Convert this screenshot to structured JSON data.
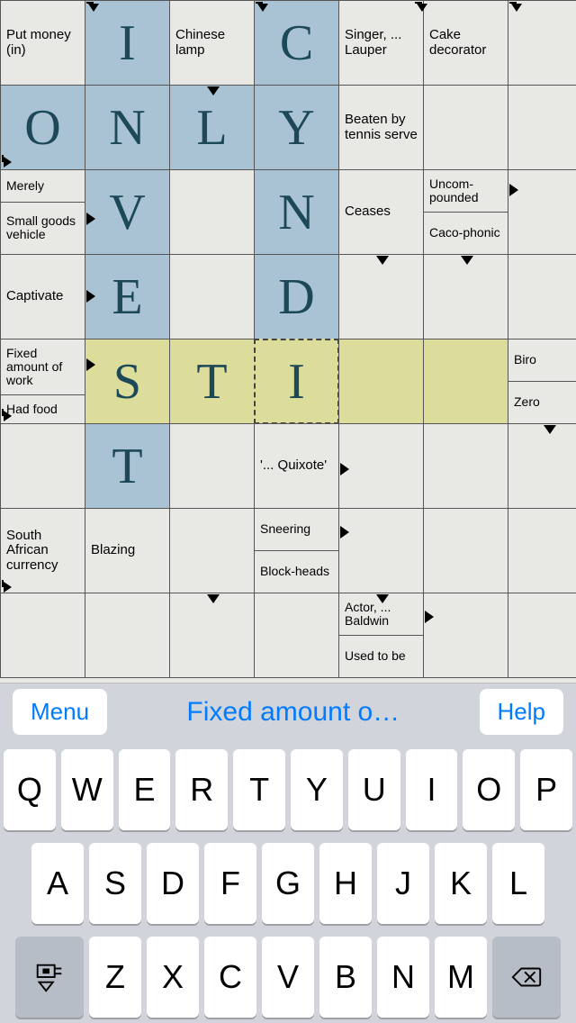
{
  "grid": {
    "cellSize": 95,
    "cols": 7,
    "rows": 8
  },
  "clues": {
    "put_money": "Put money (in)",
    "chinese_lamp": "Chinese lamp",
    "singer_lauper": "Singer, ... Lauper",
    "cake_decorator": "Cake decorator",
    "beaten_tennis": "Beaten by tennis serve",
    "merely": "Merely",
    "small_goods": "Small goods vehicle",
    "ceases": "Ceases",
    "uncompounded": "Uncom-pounded",
    "cacophonic": "Caco-phonic",
    "captivate": "Captivate",
    "fixed_amount": "Fixed amount of work",
    "had_food": "Had food",
    "biro": "Biro",
    "zero": "Zero",
    "quixote": "'... Quixote'",
    "south_african": "South African currency",
    "blazing": "Blazing",
    "sneering": "Sneering",
    "blockheads": "Block-heads",
    "actor_baldwin": "Actor, ... Baldwin",
    "used_to_be": "Used to be"
  },
  "letters": {
    "r0c1": "I",
    "r0c3": "C",
    "r1c0": "O",
    "r1c1": "N",
    "r1c2": "L",
    "r1c3": "Y",
    "r2c1": "V",
    "r2c3": "N",
    "r3c1": "E",
    "r3c3": "D",
    "r4c1": "S",
    "r4c2": "T",
    "r4c3": "I",
    "r5c1": "T"
  },
  "toolbar": {
    "menu": "Menu",
    "help": "Help",
    "current_clue": "Fixed amount o…"
  },
  "keyboard": {
    "row1": [
      "Q",
      "W",
      "E",
      "R",
      "T",
      "Y",
      "U",
      "I",
      "O",
      "P"
    ],
    "row2": [
      "A",
      "S",
      "D",
      "F",
      "G",
      "H",
      "J",
      "K",
      "L"
    ],
    "row3": [
      "Z",
      "X",
      "C",
      "V",
      "B",
      "N",
      "M"
    ]
  }
}
